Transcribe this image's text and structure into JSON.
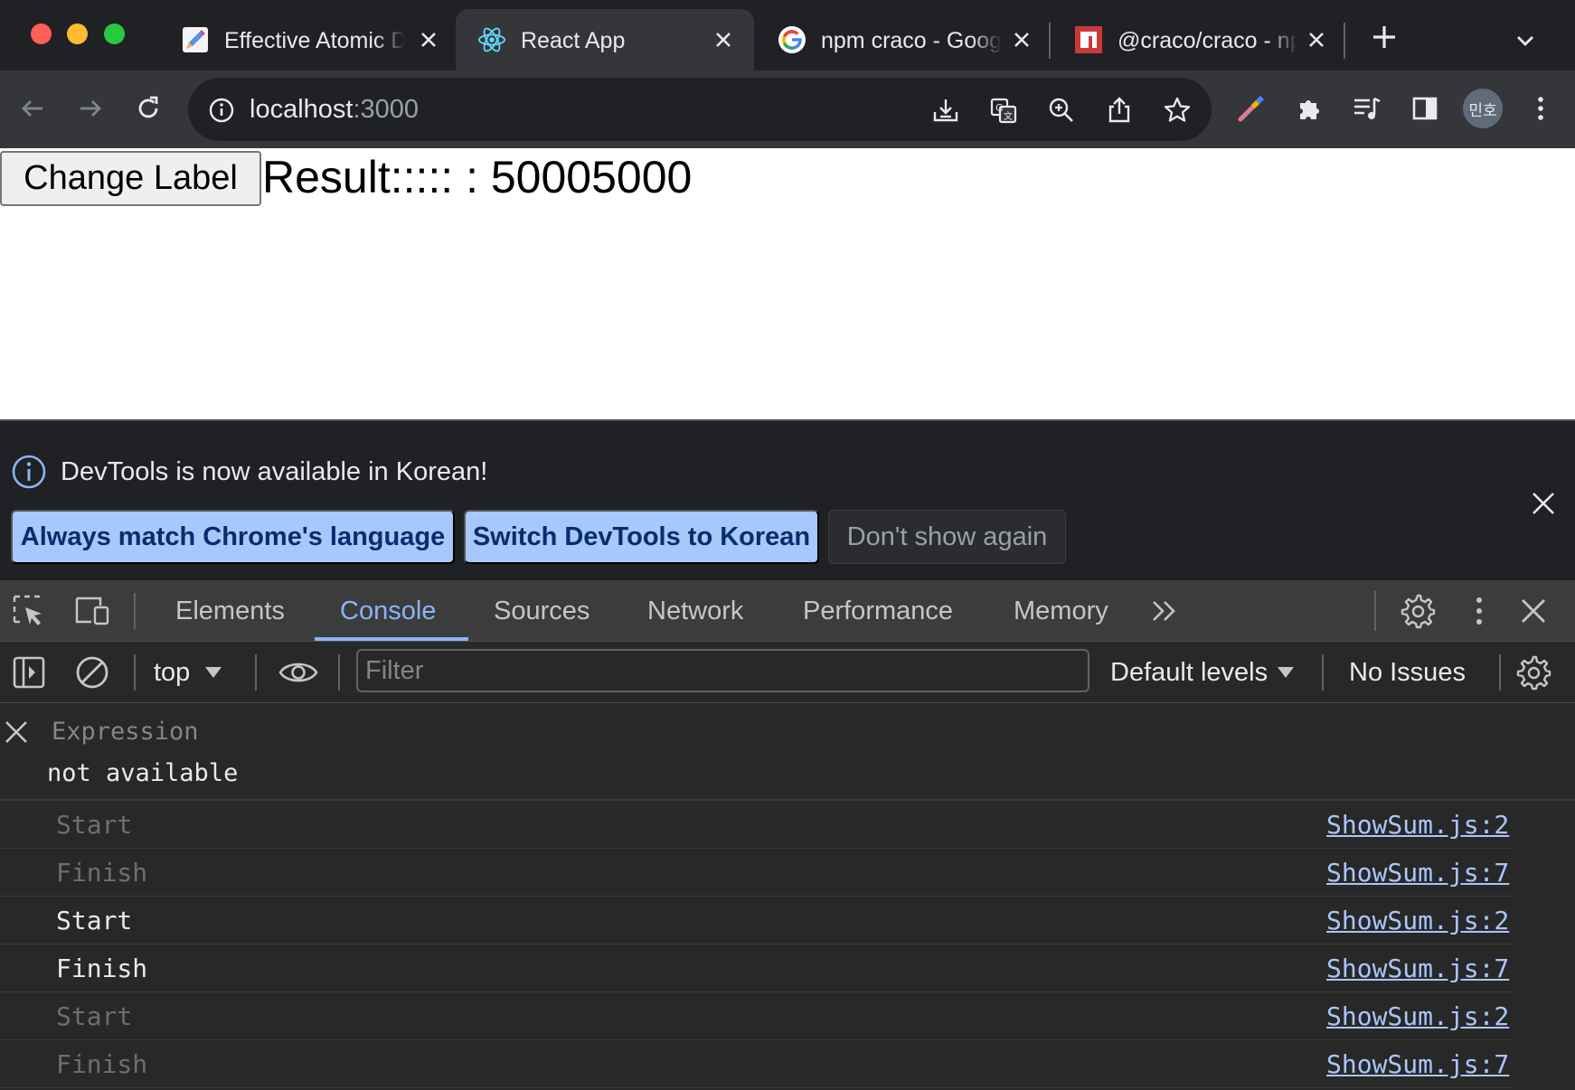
{
  "browser": {
    "tabs": [
      {
        "title": "Effective Atomic Design",
        "icon": "edit-pencil-icon",
        "active": false
      },
      {
        "title": "React App",
        "icon": "react-icon",
        "active": true
      },
      {
        "title": "npm craco - Google Search",
        "icon": "google-icon",
        "active": false
      },
      {
        "title": "@craco/craco - npm",
        "icon": "npm-icon",
        "active": false
      }
    ],
    "new_tab_icon": "plus-icon",
    "tab_search_icon": "chevron-down-icon"
  },
  "toolbar": {
    "url_host": "localhost",
    "url_port": ":3000",
    "profile_initials": "민호"
  },
  "page": {
    "button_label": "Change Label",
    "result_text": "Result::::: : 50005000"
  },
  "devtools": {
    "infobar": {
      "message": "DevTools is now available in Korean!",
      "btn_match": "Always match Chrome's language",
      "btn_switch": "Switch DevTools to Korean",
      "btn_dismiss": "Don't show again"
    },
    "tabs": [
      "Elements",
      "Console",
      "Sources",
      "Network",
      "Performance",
      "Memory"
    ],
    "active_tab": "Console",
    "console_toolbar": {
      "context": "top",
      "filter_placeholder": "Filter",
      "levels": "Default levels",
      "issues": "No Issues"
    },
    "expression": {
      "label": "Expression",
      "value": "not available"
    },
    "logs": [
      {
        "message": "Start",
        "source": "ShowSum.js:2",
        "dim": true
      },
      {
        "message": "Finish",
        "source": "ShowSum.js:7",
        "dim": true
      },
      {
        "message": "Start",
        "source": "ShowSum.js:2",
        "dim": false
      },
      {
        "message": "Finish",
        "source": "ShowSum.js:7",
        "dim": false
      },
      {
        "message": "Start",
        "source": "ShowSum.js:2",
        "dim": true
      },
      {
        "message": "Finish",
        "source": "ShowSum.js:7",
        "dim": true
      }
    ]
  },
  "colors": {
    "accent": "#8ab4f8",
    "button_primary": "#a8c7fa",
    "link": "#a8c7fa"
  }
}
